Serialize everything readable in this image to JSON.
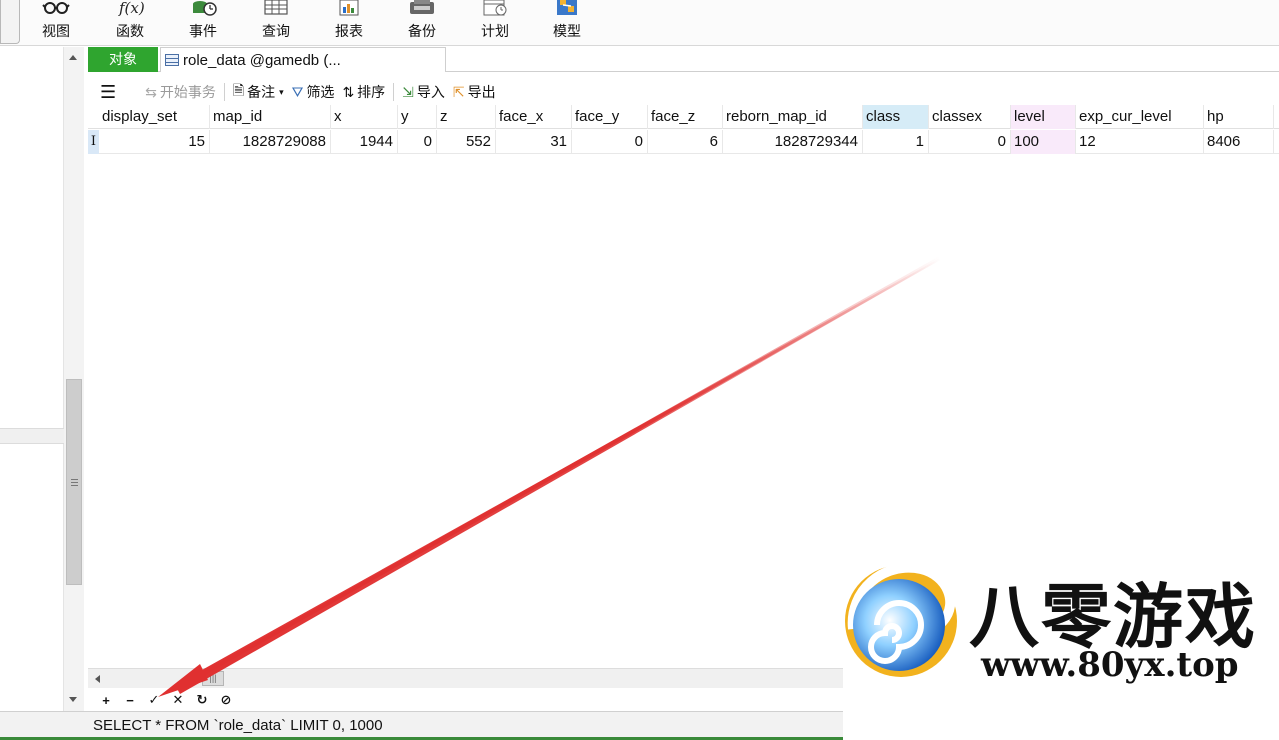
{
  "ribbon": {
    "items": [
      {
        "label": "视图",
        "icon": "glasses-icon"
      },
      {
        "label": "函数",
        "icon": "function-icon",
        "glyph": "f(x)"
      },
      {
        "label": "事件",
        "icon": "event-clock-icon"
      },
      {
        "label": "查询",
        "icon": "query-grid-icon"
      },
      {
        "label": "报表",
        "icon": "report-chart-icon"
      },
      {
        "label": "备份",
        "icon": "backup-icon"
      },
      {
        "label": "计划",
        "icon": "schedule-icon"
      },
      {
        "label": "模型",
        "icon": "model-icon"
      }
    ]
  },
  "tabs": {
    "objects_label": "对象",
    "table_tab_label": "role_data @gamedb (..."
  },
  "toolbar": {
    "menu_icon": "hamburger-icon",
    "begin_transaction": "开始事务",
    "memo": "备注",
    "filter": "筛选",
    "sort": "排序",
    "import": "导入",
    "export": "导出"
  },
  "grid": {
    "columns": [
      "display_set",
      "map_id",
      "x",
      "y",
      "z",
      "face_x",
      "face_y",
      "face_z",
      "reborn_map_id",
      "class",
      "classex",
      "level",
      "exp_cur_level",
      "hp"
    ],
    "row_marker": "I",
    "rows": [
      [
        "15",
        "1828729088",
        "1944",
        "0",
        "552",
        "31",
        "0",
        "6",
        "1828729344",
        "1",
        "0",
        "100",
        "12",
        "8406"
      ]
    ],
    "highlight_colors": {
      "class": "#d6ecf7",
      "level": "#f9eafa"
    }
  },
  "navbar": {
    "add": "+",
    "delete": "−",
    "apply": "✓",
    "discard": "✕",
    "refresh": "↻",
    "stop": "⊘"
  },
  "status": {
    "sql": "SELECT * FROM `role_data` LIMIT 0, 1000"
  },
  "watermark": {
    "brand": "八零游戏",
    "url": "www.80yx.top"
  },
  "colors": {
    "tab_active": "#2fa52f",
    "arrow": "#e03030"
  }
}
